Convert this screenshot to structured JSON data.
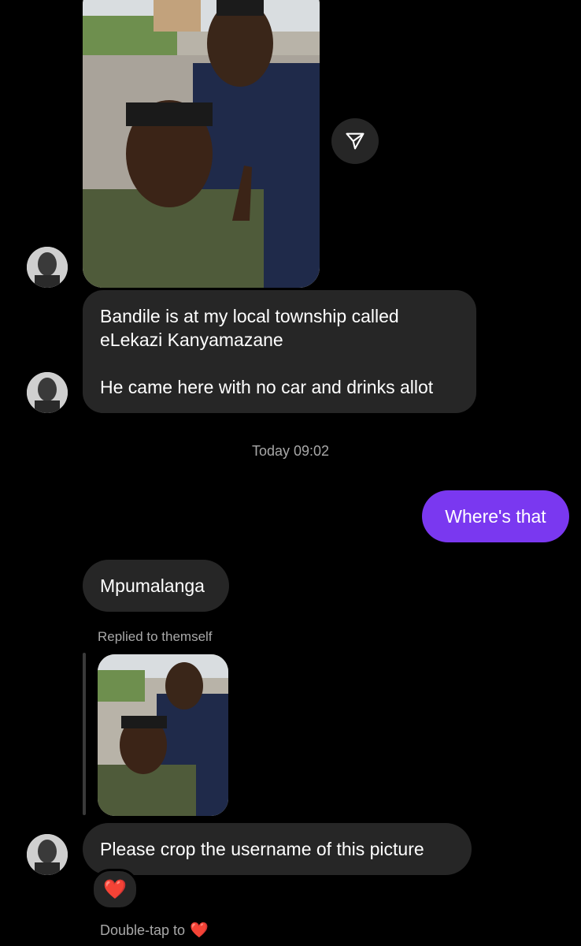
{
  "messages": {
    "long_line1": "Bandile is at my local township called",
    "long_line2": "eLekazi Kanyamazane",
    "long_line3": "He came here with no car and drinks allot",
    "timestamp": "Today 09:02",
    "sent_text": "Where's that",
    "reply_text": "Mpumalanga",
    "replied_label": "Replied to themself",
    "crop_text": "Please crop the username of this picture",
    "reaction": "❤️",
    "hint_text": "Double-tap to",
    "hint_icon": "❤️"
  },
  "icons": {
    "share": "paper-plane-icon",
    "heart": "heart-icon"
  },
  "colors": {
    "background": "#000000",
    "incoming_bubble": "#262626",
    "outgoing_bubble": "#7a38f0",
    "muted_text": "#a8a8a8",
    "heart": "#ff2b3e"
  }
}
